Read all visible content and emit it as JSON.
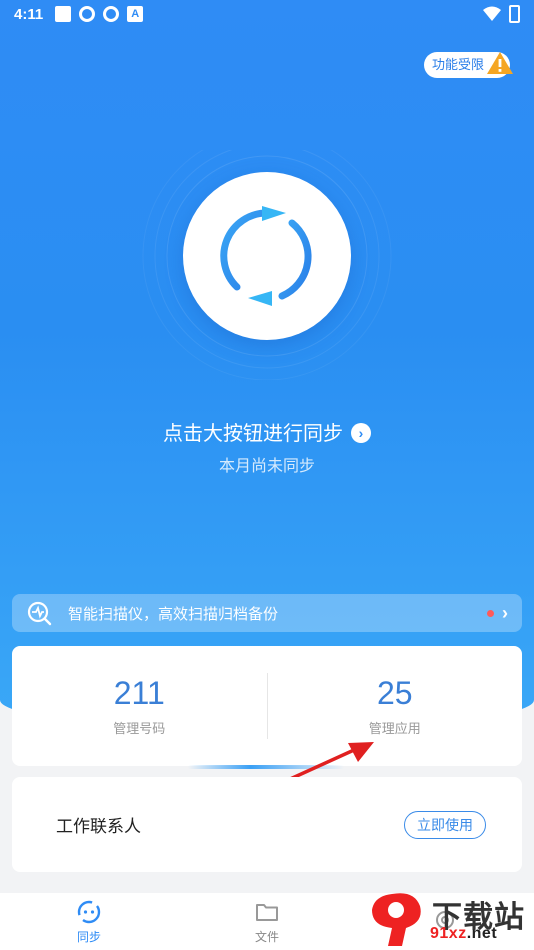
{
  "status_bar": {
    "time": "4:11",
    "notif_letter": "A"
  },
  "limit_badge": {
    "label": "功能受限"
  },
  "hero": {
    "title": "点击大按钮进行同步",
    "chevron": "›",
    "subtitle": "本月尚未同步"
  },
  "scan_banner": {
    "text": "智能扫描仪，高效扫描归档备份",
    "chevron": "›"
  },
  "stats": [
    {
      "value": "211",
      "label": "管理号码"
    },
    {
      "value": "25",
      "label": "管理应用"
    }
  ],
  "contacts": {
    "title": "工作联系人",
    "button": "立即使用"
  },
  "nav": [
    {
      "label": "同步",
      "icon": "sync-icon",
      "active": true
    },
    {
      "label": "文件",
      "icon": "folder-icon",
      "active": false
    },
    {
      "label": "",
      "icon": "gear-icon",
      "active": false
    }
  ],
  "watermark": {
    "brand": "下载站",
    "domain_left": "91xz",
    "domain_right": ".net"
  },
  "colors": {
    "primary": "#2f8cf5",
    "accent_text": "#3a7fd6",
    "warning": "#f5a623",
    "annotation": "#e02020"
  }
}
